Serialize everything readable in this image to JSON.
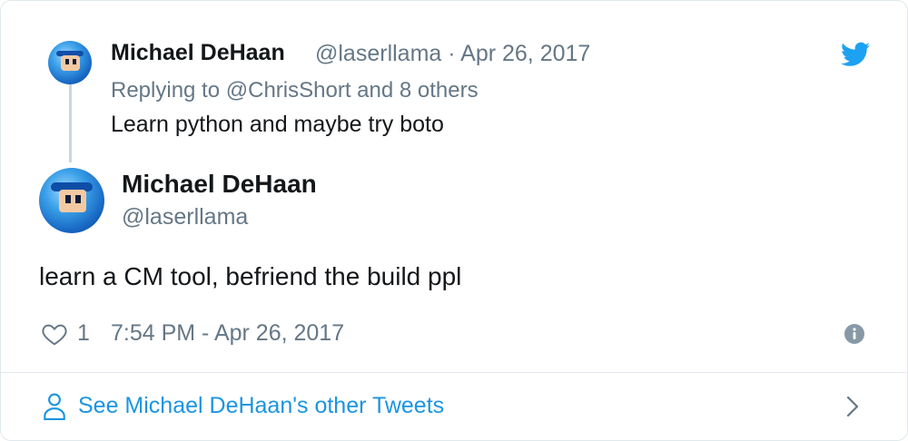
{
  "reply": {
    "name": "Michael DeHaan",
    "meta": "@laserllama · Apr 26, 2017",
    "replying_prefix": "Replying to",
    "replying_user": "@ChrisShort",
    "replying_suffix": "and 8 others",
    "text": "Learn python and maybe try boto"
  },
  "tweet": {
    "name": "Michael DeHaan",
    "handle": "@laserllama",
    "text": "learn a CM tool, befriend the build ppl",
    "likes": "1",
    "timestamp": "7:54 PM - Apr 26, 2017"
  },
  "footer": {
    "link_text": "See Michael DeHaan's other Tweets"
  },
  "colors": {
    "accent": "#1da1f2",
    "link": "#1b95e0",
    "muted": "#657786",
    "text": "#14171a"
  },
  "icons": [
    "twitter-bird-icon",
    "heart-icon",
    "info-icon",
    "person-icon",
    "chevron-right-icon"
  ]
}
